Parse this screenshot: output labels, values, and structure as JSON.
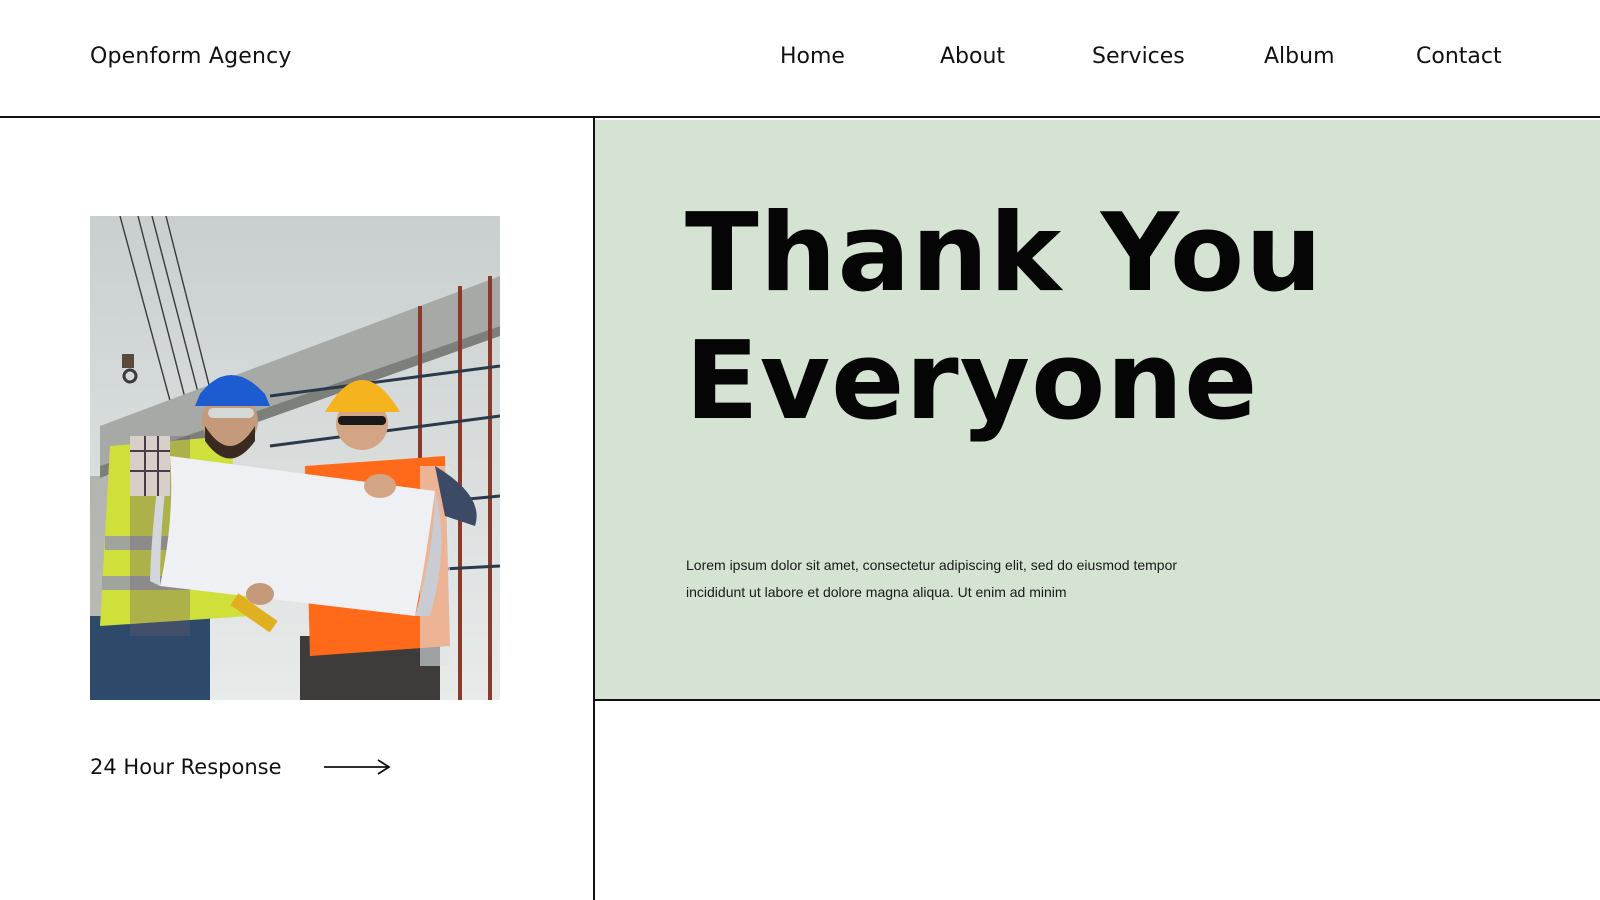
{
  "header": {
    "brand": "Openform Agency",
    "nav": [
      {
        "label": "Home"
      },
      {
        "label": "About"
      },
      {
        "label": "Services"
      },
      {
        "label": "Album"
      },
      {
        "label": "Contact"
      }
    ]
  },
  "hero": {
    "title_line1": "Thank You",
    "title_line2": "Everyone",
    "body_line1": "Lorem ipsum dolor sit amet, consectetur adipiscing elit, sed do eiusmod tempor",
    "body_line2": "incididunt ut labore et dolore magna aliqua. Ut enim ad minim"
  },
  "cta": {
    "label": "24 Hour Response",
    "icon": "arrow-right-icon"
  },
  "colors": {
    "panel_green": "#d4e3d2",
    "text": "#111111",
    "background": "#ffffff"
  }
}
